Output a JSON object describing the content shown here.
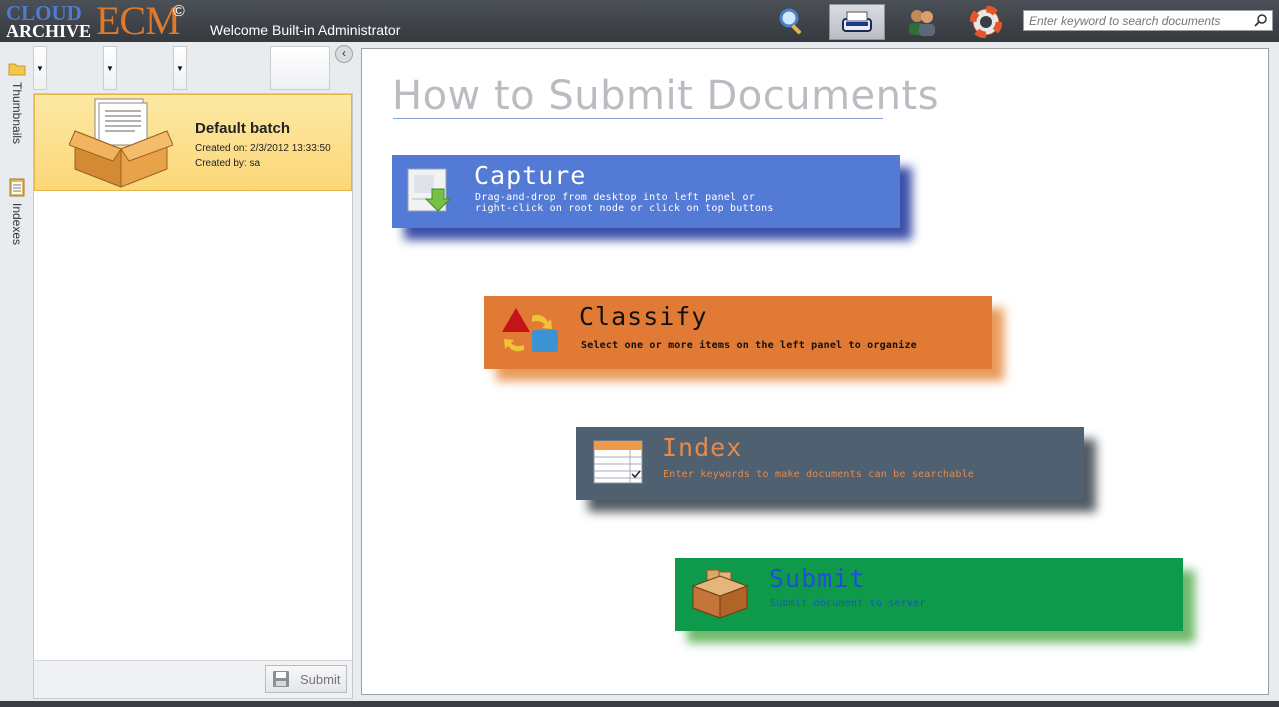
{
  "app": {
    "logo_cloud": "CLOUD",
    "logo_archive": "ARCHIVE",
    "logo_ecm": "ECM",
    "logo_copyright": "©",
    "welcome": "Welcome Built-in Administrator"
  },
  "topnav": {
    "icons": [
      "search-icon",
      "scanner-icon",
      "users-icon",
      "help-lifebuoy-icon"
    ],
    "active": "scanner-icon",
    "search_placeholder": "Enter keyword to search documents"
  },
  "sidetabs": [
    {
      "label": "Thumbnails",
      "icon": "folder-icon"
    },
    {
      "label": "Indexes",
      "icon": "clipboard-icon"
    }
  ],
  "toolbar": {
    "buttons": [
      "scan-button",
      "import-button",
      "webcam-button",
      "settings-button"
    ],
    "collapse_glyph": "‹"
  },
  "batch": {
    "name": "Default batch",
    "created_on": "Created on: 2/3/2012 13:33:50",
    "created_by": "Created by: sa"
  },
  "panel": {
    "submit_label": "Submit"
  },
  "main": {
    "title": "How to Submit Documents",
    "steps": [
      {
        "title": "Capture",
        "desc": "Drag-and-drop from desktop into left panel or\nright-click on root node or click on top buttons",
        "color": "#537ad5",
        "title_color": "#ffffff",
        "desc_color": "#ffffff"
      },
      {
        "title": "Classify",
        "desc": "Select one or more items on the left panel to organize",
        "color": "#e07a35",
        "title_color": "#111111",
        "desc_color": "#111111"
      },
      {
        "title": "Index",
        "desc": "Enter keywords to make documents can be searchable",
        "color": "#4f6070",
        "title_color": "#e68a4a",
        "desc_color": "#e68a4a"
      },
      {
        "title": "Submit",
        "desc": "Submit document to server",
        "color": "#0e9a4a",
        "title_color": "#1f4fd8",
        "desc_color": "#1f4fd8"
      }
    ]
  }
}
